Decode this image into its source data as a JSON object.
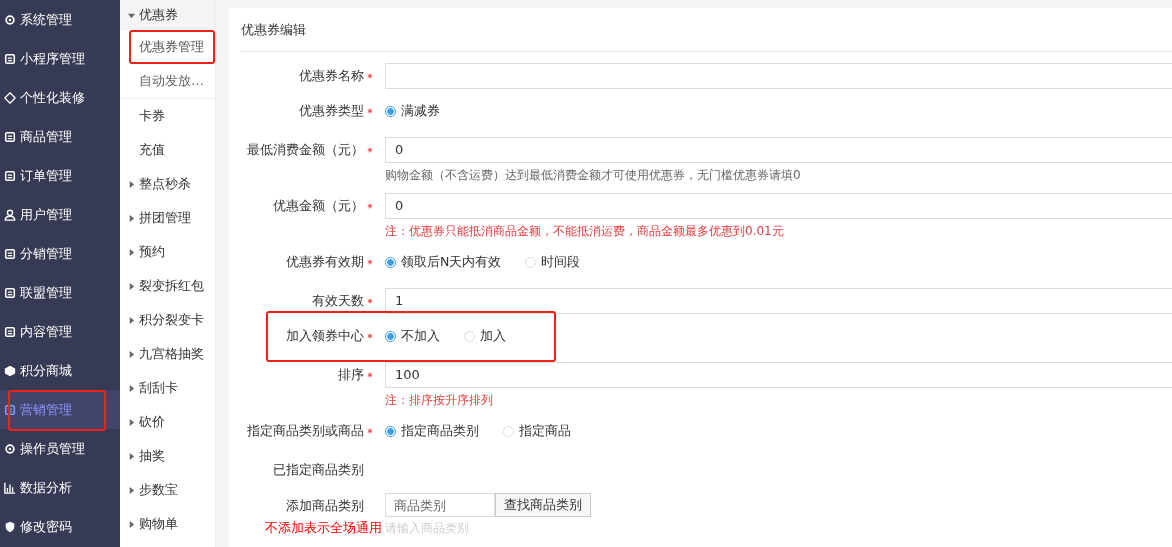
{
  "sidebar": {
    "items": [
      {
        "label": "系统管理",
        "selected": false,
        "highlighted": false
      },
      {
        "label": "小程序管理",
        "selected": false,
        "highlighted": false
      },
      {
        "label": "个性化装修",
        "selected": false,
        "highlighted": false
      },
      {
        "label": "商品管理",
        "selected": false,
        "highlighted": false
      },
      {
        "label": "订单管理",
        "selected": false,
        "highlighted": false
      },
      {
        "label": "用户管理",
        "selected": false,
        "highlighted": false
      },
      {
        "label": "分销管理",
        "selected": false,
        "highlighted": false
      },
      {
        "label": "联盟管理",
        "selected": false,
        "highlighted": false
      },
      {
        "label": "内容管理",
        "selected": false,
        "highlighted": false
      },
      {
        "label": "积分商城",
        "selected": false,
        "highlighted": false
      },
      {
        "label": "营销管理",
        "selected": true,
        "highlighted": true
      },
      {
        "label": "操作员管理",
        "selected": false,
        "highlighted": false
      },
      {
        "label": "数据分析",
        "selected": false,
        "highlighted": false
      },
      {
        "label": "修改密码",
        "selected": false,
        "highlighted": false
      }
    ]
  },
  "submenu": {
    "items": [
      {
        "kind": "group",
        "label": "优惠券",
        "expanded": true,
        "children": [
          {
            "label": "优惠券管理",
            "selected": true,
            "highlighted": true
          },
          {
            "label": "自动发放…",
            "selected": false,
            "highlighted": false
          }
        ]
      },
      {
        "kind": "link",
        "label": "卡券"
      },
      {
        "kind": "link",
        "label": "充值"
      },
      {
        "kind": "group",
        "label": "整点秒杀",
        "expanded": false
      },
      {
        "kind": "group",
        "label": "拼团管理",
        "expanded": false
      },
      {
        "kind": "group",
        "label": "预约",
        "expanded": false
      },
      {
        "kind": "group",
        "label": "裂变拆红包",
        "expanded": false
      },
      {
        "kind": "group",
        "label": "积分裂变卡",
        "expanded": false
      },
      {
        "kind": "group",
        "label": "九宫格抽奖",
        "expanded": false
      },
      {
        "kind": "group",
        "label": "刮刮卡",
        "expanded": false
      },
      {
        "kind": "group",
        "label": "砍价",
        "expanded": false
      },
      {
        "kind": "group",
        "label": "抽奖",
        "expanded": false
      },
      {
        "kind": "group",
        "label": "步数宝",
        "expanded": false
      },
      {
        "kind": "group",
        "label": "购物单",
        "expanded": false
      }
    ]
  },
  "form": {
    "title": "优惠券编辑",
    "fields": [
      {
        "kind": "text",
        "label": "优惠券名称",
        "required": true,
        "highlighted": false
      },
      {
        "kind": "radio",
        "label": "优惠券类型",
        "required": true,
        "highlighted": false,
        "options": [
          {
            "label": "满减券",
            "selected": true
          }
        ]
      },
      {
        "kind": "text",
        "label": "最低消费金额（元）",
        "required": true,
        "highlighted": false,
        "value": "0",
        "hint": {
          "kind": "help",
          "text": "购物金额（不含运费）达到最低消费金额才可使用优惠券，无门槛优惠券请填0"
        }
      },
      {
        "kind": "text",
        "label": "优惠金额（元）",
        "required": true,
        "highlighted": false,
        "value": "0",
        "hint": {
          "kind": "note",
          "text": "注：优惠券只能抵消商品金额，不能抵消运费，商品金额最多优惠到0.01元"
        }
      },
      {
        "kind": "radio",
        "label": "优惠券有效期",
        "required": true,
        "highlighted": false,
        "options": [
          {
            "label": "领取后N天内有效",
            "selected": true
          },
          {
            "label": "时间段",
            "selected": false
          }
        ]
      },
      {
        "kind": "text",
        "label": "有效天数",
        "required": true,
        "highlighted": false,
        "value": "1"
      },
      {
        "kind": "radio",
        "label": "加入领券中心",
        "required": true,
        "highlighted": true,
        "options": [
          {
            "label": "不加入",
            "selected": true
          },
          {
            "label": "加入",
            "selected": false
          }
        ]
      },
      {
        "kind": "text",
        "label": "排序",
        "required": true,
        "highlighted": false,
        "value": "100",
        "hint": {
          "kind": "note",
          "text": "注：排序按升序排列"
        }
      },
      {
        "kind": "radio",
        "label": "指定商品类别或商品",
        "required": true,
        "highlighted": false,
        "options": [
          {
            "label": "指定商品类别",
            "selected": true
          },
          {
            "label": "指定商品",
            "selected": false
          }
        ]
      },
      {
        "kind": "static",
        "label": "已指定商品类别",
        "required": false,
        "highlighted": false
      },
      {
        "kind": "search",
        "label": "添加商品类别",
        "required": false,
        "highlighted": false,
        "label_note": "不添加表示全场通用",
        "placeholder": "商品类别",
        "button": "查找商品类别",
        "hint": {
          "kind": "faint",
          "text": "请输入商品类别"
        }
      }
    ]
  }
}
